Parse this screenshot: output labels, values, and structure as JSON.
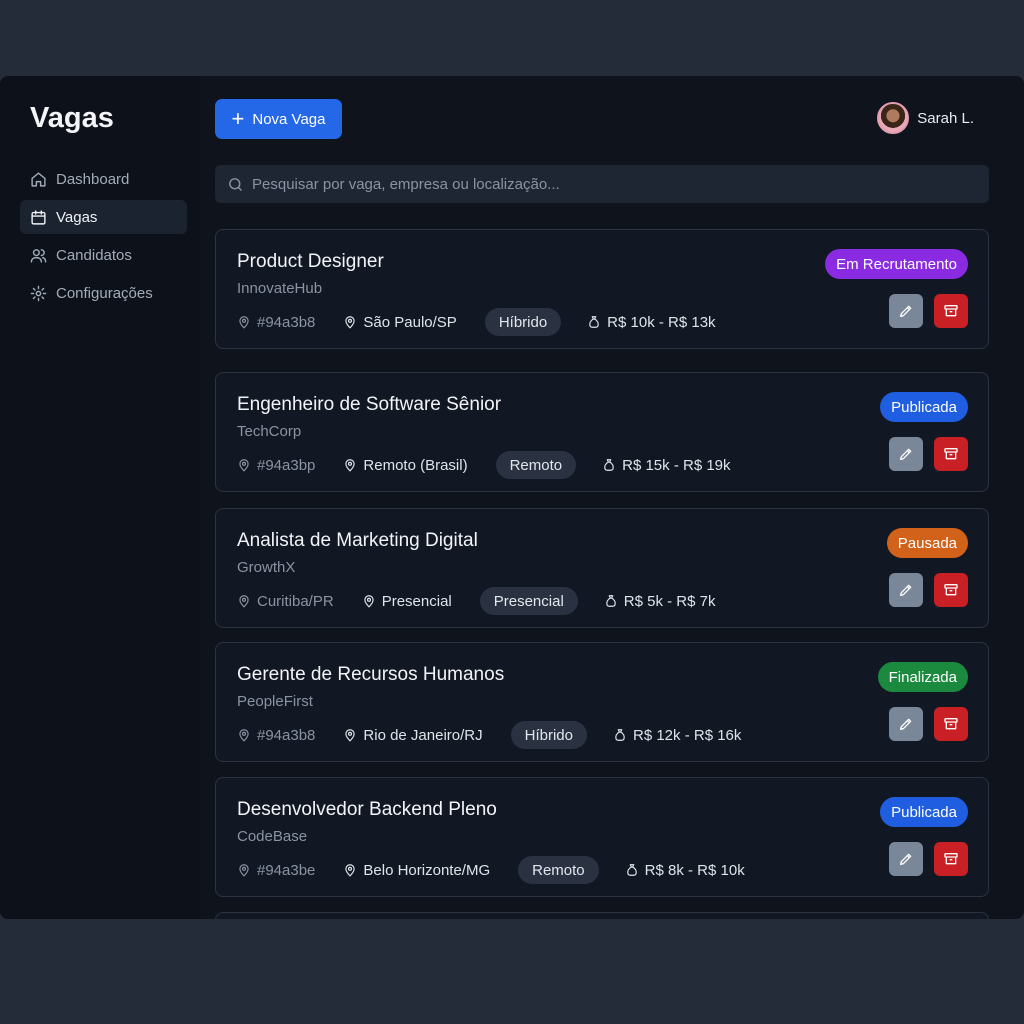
{
  "sidebar": {
    "title": "Vagas",
    "items": [
      {
        "label": "Dashboard",
        "icon": "home-icon",
        "active": false
      },
      {
        "label": "Vagas",
        "icon": "calendar-icon",
        "active": true
      },
      {
        "label": "Candidatos",
        "icon": "users-icon",
        "active": false
      },
      {
        "label": "Configurações",
        "icon": "gear-icon",
        "active": false
      }
    ]
  },
  "header": {
    "new_button_label": "Nova Vaga",
    "user_name": "Sarah L."
  },
  "search": {
    "placeholder": "Pesquisar por vaga, empresa ou localização..."
  },
  "colors": {
    "primary": "#2468e8",
    "status_recruiting": "#8a2be2",
    "status_published": "#1f5ee0",
    "status_paused": "#d2621a",
    "status_finished": "#1b8a3e",
    "archive": "#c82024",
    "edit": "#7a8799"
  },
  "jobs": [
    {
      "title": "Product Designer",
      "company": "InnovateHub",
      "code": "#94a3b8",
      "location": "São Paulo/SP",
      "mode": "Híbrido",
      "salary": "R$ 10k - R$ 13k",
      "status": "Em Recrutamento",
      "status_color": "#8a2be2"
    },
    {
      "title": "Engenheiro de Software Sênior",
      "company": "TechCorp",
      "code": "#94a3bp",
      "location": "Remoto (Brasil)",
      "mode": "Remoto",
      "salary": "R$ 15k - R$ 19k",
      "status": "Publicada",
      "status_color": "#1f5ee0"
    },
    {
      "title": "Analista de Marketing Digital",
      "company": "GrowthX",
      "code": "Curitiba/PR",
      "location": "Presencial",
      "mode": "Presencial",
      "salary": "R$ 5k - R$ 7k",
      "status": "Pausada",
      "status_color": "#d2621a"
    },
    {
      "title": "Gerente de Recursos Humanos",
      "company": "PeopleFirst",
      "code": "#94a3b8",
      "location": "Rio de Janeiro/RJ",
      "mode": "Híbrido",
      "salary": "R$ 12k - R$ 16k",
      "status": "Finalizada",
      "status_color": "#1b8a3e"
    },
    {
      "title": "Desenvolvedor Backend Pleno",
      "company": "CodeBase",
      "code": "#94a3be",
      "location": "Belo Horizonte/MG",
      "mode": "Remoto",
      "salary": "R$ 8k - R$ 10k",
      "status": "Publicada",
      "status_color": "#1f5ee0"
    }
  ]
}
